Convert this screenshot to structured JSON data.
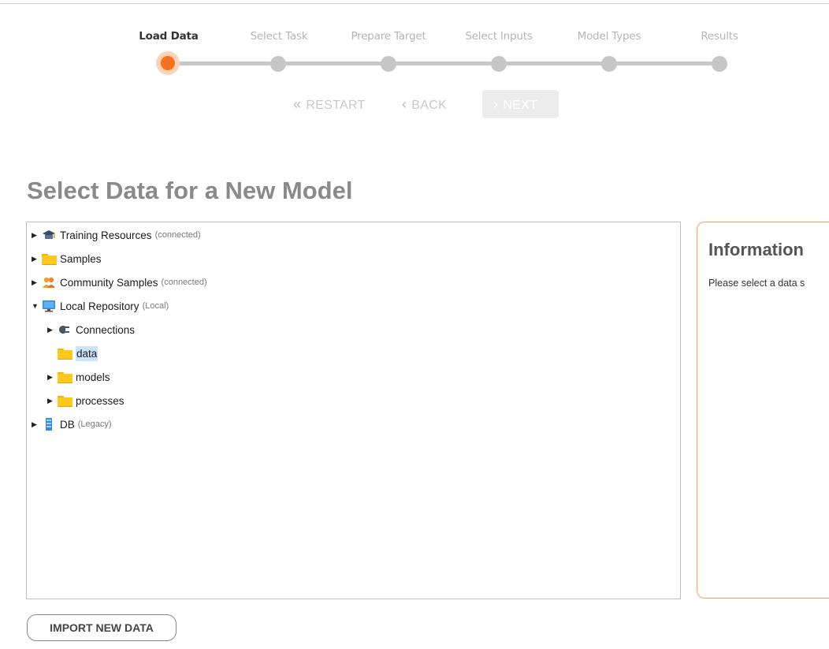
{
  "wizard": {
    "steps": [
      {
        "label": "Load Data",
        "active": true
      },
      {
        "label": "Select Task",
        "active": false
      },
      {
        "label": "Prepare Target",
        "active": false
      },
      {
        "label": "Select Inputs",
        "active": false
      },
      {
        "label": "Model Types",
        "active": false
      },
      {
        "label": "Results",
        "active": false
      }
    ],
    "restart_label": "RESTART",
    "back_label": "BACK",
    "next_label": "NEXT"
  },
  "page_title": "Select Data for a New Model",
  "tree": {
    "items": [
      {
        "label": "Training Resources",
        "sub": "(connected)",
        "icon": "graduation-cap-icon"
      },
      {
        "label": "Samples",
        "sub": "",
        "icon": "folder-icon"
      },
      {
        "label": "Community Samples",
        "sub": "(connected)",
        "icon": "people-icon"
      },
      {
        "label": "Local Repository",
        "sub": "(Local)",
        "icon": "monitor-icon"
      },
      {
        "label": "Connections",
        "sub": "",
        "icon": "plug-icon"
      },
      {
        "label": "data",
        "sub": "",
        "icon": "folder-icon"
      },
      {
        "label": "models",
        "sub": "",
        "icon": "folder-icon"
      },
      {
        "label": "processes",
        "sub": "",
        "icon": "folder-icon"
      },
      {
        "label": "DB",
        "sub": "(Legacy)",
        "icon": "database-icon"
      }
    ]
  },
  "info": {
    "title": "Information",
    "text": "Please select a data s"
  },
  "import_button_label": "IMPORT NEW DATA",
  "colors": {
    "accent": "#f5731e",
    "selection": "#cde3fb",
    "info_border": "#f5a264"
  }
}
